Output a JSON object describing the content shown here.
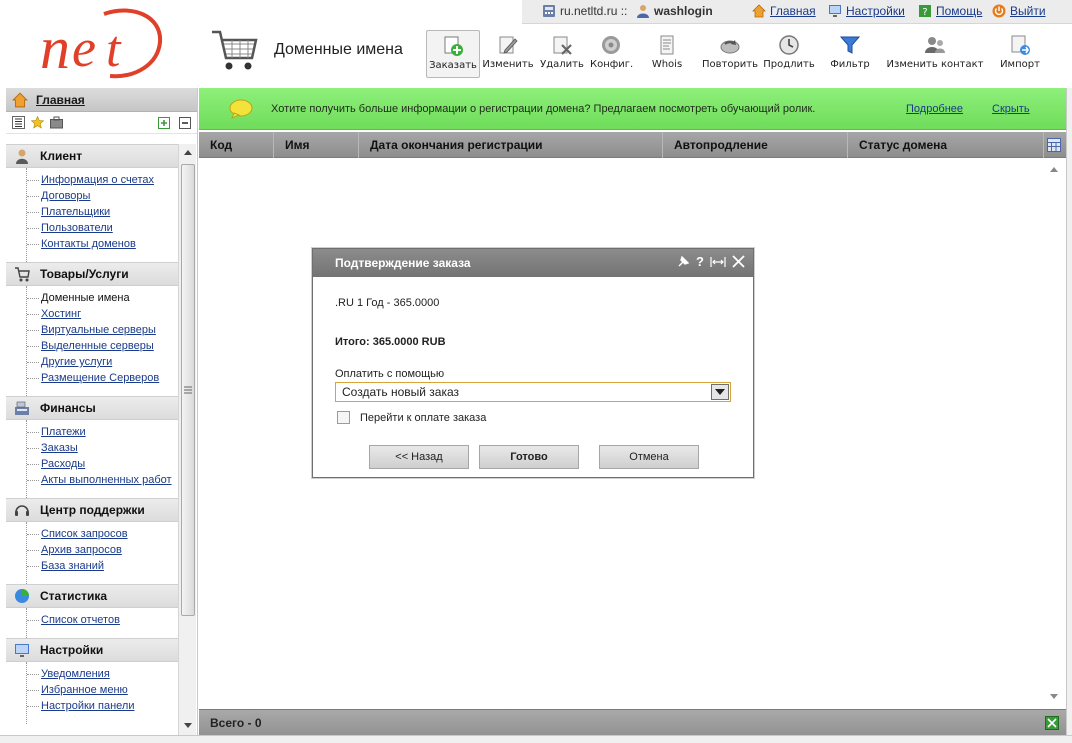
{
  "topbar": {
    "site": "ru.netltd.ru ::",
    "user": "washlogin",
    "links": [
      "Главная",
      "Настройки",
      "Помощь",
      "Выйти"
    ]
  },
  "header": {
    "title": "Доменные имена"
  },
  "toolbar": [
    "Заказать",
    "Изменить",
    "Удалить",
    "Конфиг.",
    "Whois",
    "Повторить",
    "Продлить",
    "Фильтр",
    "Изменить контакт",
    "Импорт"
  ],
  "sidebar": {
    "home": "Главная",
    "groups": [
      {
        "title": "Клиент",
        "items": [
          "Информация о счетах",
          "Договоры",
          "Плательщики",
          "Пользователи",
          "Контакты доменов"
        ]
      },
      {
        "title": "Товары/Услуги",
        "items": [
          "Доменные имена",
          "Хостинг",
          "Виртуальные серверы",
          "Выделенные серверы",
          "Другие услуги",
          "Размещение Серверов"
        ]
      },
      {
        "title": "Финансы",
        "items": [
          "Платежи",
          "Заказы",
          "Расходы",
          "Акты выполненных работ"
        ]
      },
      {
        "title": "Центр поддержки",
        "items": [
          "Список запросов",
          "Архив запросов",
          "База знаний"
        ]
      },
      {
        "title": "Статистика",
        "items": [
          "Список отчетов"
        ]
      },
      {
        "title": "Настройки",
        "items": [
          "Уведомления",
          "Избранное меню",
          "Настройки панели"
        ]
      }
    ]
  },
  "banner": {
    "message": "Хотите получить больше информации о регистрации домена? Предлагаем посмотреть обучающий ролик.",
    "more": "Подробнее",
    "hide": "Скрыть"
  },
  "grid": {
    "columns": [
      "Код",
      "Имя",
      "Дата окончания регистрации",
      "Автопродление",
      "Статус домена"
    ],
    "footer": "Всего - 0"
  },
  "dialog": {
    "title": "Подтверждение заказа",
    "item": ".RU 1 Год - 365.0000",
    "total": "Итого: 365.0000 RUB",
    "pay_label": "Оплатить с помощью",
    "pay_value": "Создать новый заказ",
    "checkbox": "Перейти к оплате заказа",
    "btn_back": "<< Назад",
    "btn_done": "Готово",
    "btn_cancel": "Отмена"
  },
  "colors": {
    "banner": "#7ee46a",
    "logo": "#e0402a",
    "dialog_header": "#7f7f7f"
  }
}
